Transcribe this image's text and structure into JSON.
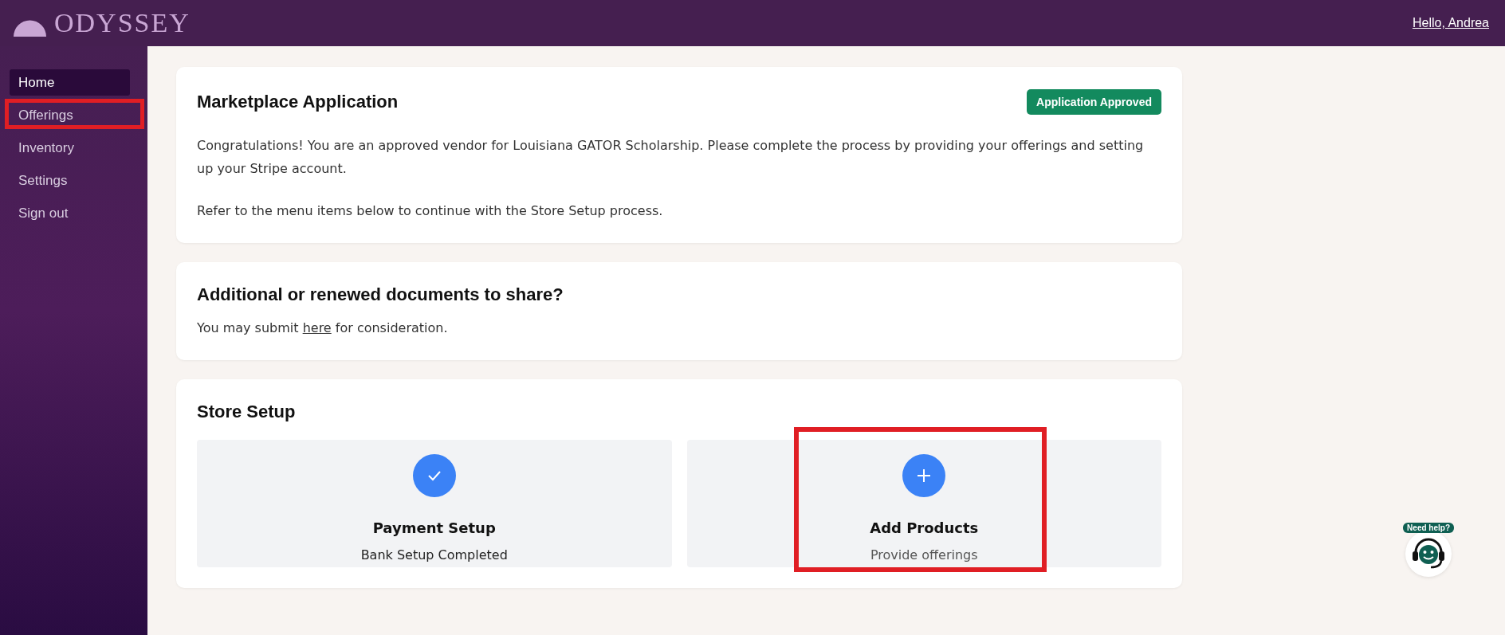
{
  "header": {
    "logo": "ODYSSEY",
    "user_link": "Hello, Andrea"
  },
  "sidebar": {
    "items": [
      {
        "label": "Home",
        "selected": true,
        "highlighted": false
      },
      {
        "label": "Offerings",
        "selected": false,
        "highlighted": true
      },
      {
        "label": "Inventory",
        "selected": false,
        "highlighted": false
      },
      {
        "label": "Settings",
        "selected": false,
        "highlighted": false
      },
      {
        "label": "Sign out",
        "selected": false,
        "highlighted": false
      }
    ]
  },
  "application": {
    "title": "Marketplace Application",
    "badge": "Application Approved",
    "paragraphs": [
      "Congratulations! You are an approved vendor for Louisiana GATOR Scholarship. Please complete the process by providing your offerings and setting up your Stripe account.",
      "Refer to the menu items below to continue with the Store Setup process."
    ]
  },
  "documents": {
    "title": "Additional or renewed documents to share?",
    "text_before": "You may submit",
    "link": "here",
    "text_after": "for consideration."
  },
  "store_setup": {
    "title": "Store Setup",
    "steps": [
      {
        "kind": "done",
        "title": "Payment Setup",
        "subtitle": "Bank Setup Completed",
        "highlighted": false
      },
      {
        "kind": "add",
        "title": "Add Products",
        "subtitle": "Provide offerings",
        "highlighted": true
      }
    ]
  },
  "help": {
    "label": "Need help?"
  }
}
